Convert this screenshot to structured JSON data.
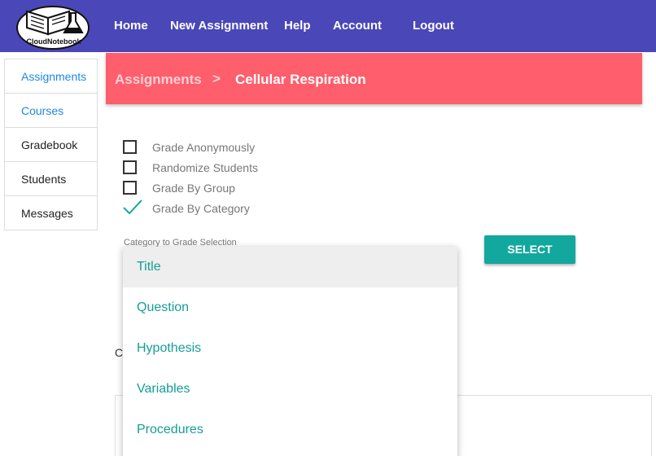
{
  "app": {
    "logo_text": "CloudNotebook",
    "brand_color": "#4a47b8"
  },
  "nav": {
    "home": "Home",
    "new_assignment": "New Assignment",
    "help": "Help",
    "account": "Account",
    "logout": "Logout"
  },
  "sidebar": {
    "items": [
      {
        "label": "Assignments"
      },
      {
        "label": "Courses"
      },
      {
        "label": "Gradebook"
      },
      {
        "label": "Students"
      },
      {
        "label": "Messages"
      }
    ]
  },
  "breadcrumb": {
    "parent": "Assignments",
    "separator": ">",
    "current": "Cellular Respiration",
    "color": "#ff5e6c"
  },
  "options": [
    {
      "label": "Grade Anonymously",
      "checked": false
    },
    {
      "label": "Randomize Students",
      "checked": false
    },
    {
      "label": "Grade By Group",
      "checked": false
    },
    {
      "label": "Grade By Category",
      "checked": true
    }
  ],
  "category_select": {
    "label": "Category to Grade Selection",
    "button_label": "SELECT",
    "accent_color": "#13a89e",
    "options": [
      {
        "label": "Title",
        "highlighted": true
      },
      {
        "label": "Question"
      },
      {
        "label": "Hypothesis"
      },
      {
        "label": "Variables"
      },
      {
        "label": "Procedures"
      }
    ]
  },
  "partial_text": "C"
}
